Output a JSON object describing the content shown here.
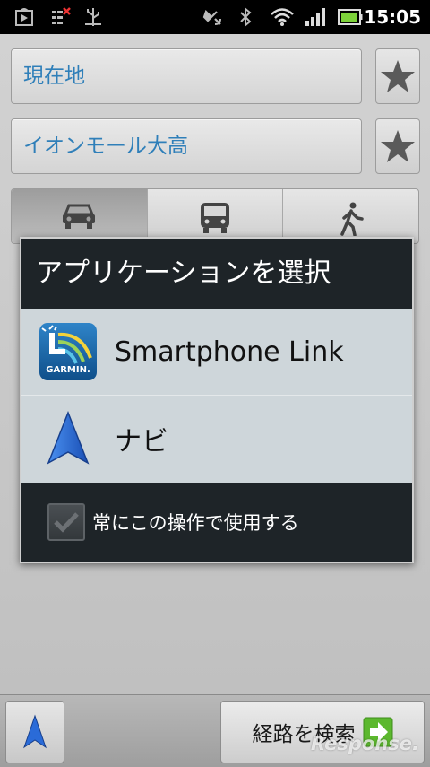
{
  "status_bar": {
    "time": "15:05",
    "icons": [
      "play-store-icon",
      "screenshot-icon",
      "usb-debug-icon",
      "gps-icon",
      "bluetooth-icon",
      "wifi-icon",
      "signal-icon",
      "battery-icon"
    ]
  },
  "route": {
    "origin": "現在地",
    "destination": "イオンモール大高",
    "modes": [
      "car-icon",
      "bus-icon",
      "walk-icon"
    ],
    "active_mode": "car"
  },
  "dialog": {
    "title": "アプリケーションを選択",
    "items": [
      {
        "label": "Smartphone Link",
        "icon": "garmin-smartphone-link-icon",
        "icon_text": "GARMIN."
      },
      {
        "label": "ナビ",
        "icon": "navigation-arrow-icon"
      }
    ],
    "always_label": "常にこの操作で使用する"
  },
  "bottom": {
    "search_label": "経路を検索",
    "watermark": "Response."
  },
  "colors": {
    "field_text": "#2f7fb9",
    "dialog_bg": "#1e2428",
    "list_bg": "#ced6da",
    "nav_blue": "#2a6bd8",
    "go_green": "#5cb82e"
  }
}
